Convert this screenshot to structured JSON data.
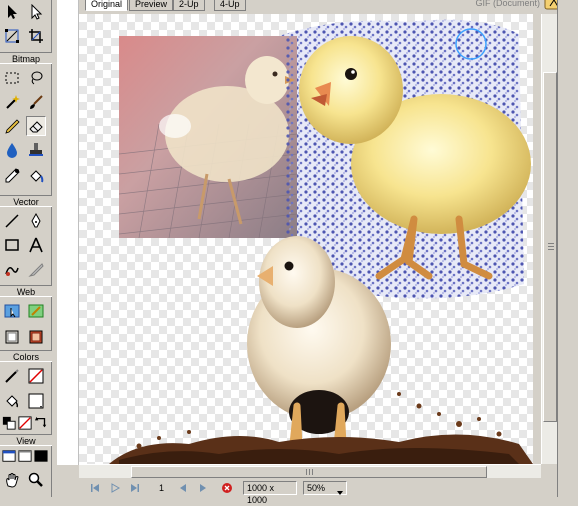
{
  "tools": {
    "sections": {
      "bitmap": "Bitmap",
      "vector": "Vector",
      "web": "Web",
      "colors": "Colors",
      "view": "View"
    },
    "icons": [
      "pointer-icon",
      "subselect-icon",
      "scale-icon",
      "crop-icon",
      "marquee-icon",
      "lasso-icon",
      "magic-wand-icon",
      "brush-icon",
      "pencil-icon",
      "eraser-icon",
      "blur-icon",
      "rubber-stamp-icon",
      "eyedropper-icon",
      "paint-bucket-icon",
      "line-icon",
      "pen-icon",
      "rectangle-icon",
      "text-icon",
      "freeform-icon",
      "knife-icon",
      "hotspot-icon",
      "slice-icon",
      "hide-slices-icon",
      "show-slices-icon",
      "stroke-color-icon",
      "fill-color-icon",
      "default-colors-icon",
      "swap-colors-icon",
      "screen-mode-icon",
      "hand-icon",
      "zoom-icon"
    ],
    "stroke_color": "#000000",
    "fill_color": "#ffffff"
  },
  "document": {
    "tabs": [
      "Original",
      "Preview",
      "2-Up",
      "4-Up"
    ],
    "active_tab": "Original",
    "format_label": "GIF (Document)"
  },
  "status": {
    "frame": "1",
    "canvas_size": "1000 x 1000",
    "zoom": "50%"
  },
  "colors": {
    "ui_bg": "#d4d0c8",
    "selection_circle": "#3ba0ff"
  }
}
